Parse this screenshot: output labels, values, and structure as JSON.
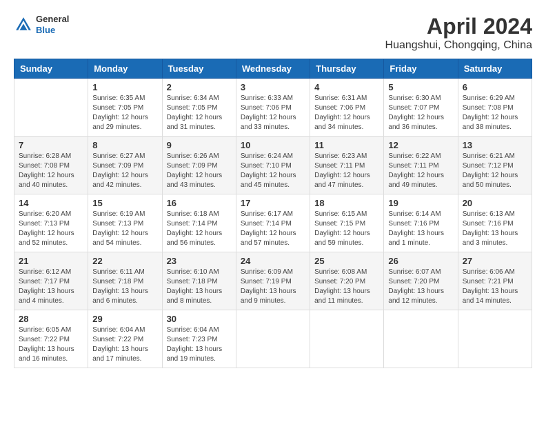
{
  "header": {
    "title": "April 2024",
    "location": "Huangshui, Chongqing, China",
    "logo_general": "General",
    "logo_blue": "Blue"
  },
  "weekdays": [
    "Sunday",
    "Monday",
    "Tuesday",
    "Wednesday",
    "Thursday",
    "Friday",
    "Saturday"
  ],
  "weeks": [
    [
      {
        "day": "",
        "sunrise": "",
        "sunset": "",
        "daylight": ""
      },
      {
        "day": "1",
        "sunrise": "Sunrise: 6:35 AM",
        "sunset": "Sunset: 7:05 PM",
        "daylight": "Daylight: 12 hours and 29 minutes."
      },
      {
        "day": "2",
        "sunrise": "Sunrise: 6:34 AM",
        "sunset": "Sunset: 7:05 PM",
        "daylight": "Daylight: 12 hours and 31 minutes."
      },
      {
        "day": "3",
        "sunrise": "Sunrise: 6:33 AM",
        "sunset": "Sunset: 7:06 PM",
        "daylight": "Daylight: 12 hours and 33 minutes."
      },
      {
        "day": "4",
        "sunrise": "Sunrise: 6:31 AM",
        "sunset": "Sunset: 7:06 PM",
        "daylight": "Daylight: 12 hours and 34 minutes."
      },
      {
        "day": "5",
        "sunrise": "Sunrise: 6:30 AM",
        "sunset": "Sunset: 7:07 PM",
        "daylight": "Daylight: 12 hours and 36 minutes."
      },
      {
        "day": "6",
        "sunrise": "Sunrise: 6:29 AM",
        "sunset": "Sunset: 7:08 PM",
        "daylight": "Daylight: 12 hours and 38 minutes."
      }
    ],
    [
      {
        "day": "7",
        "sunrise": "Sunrise: 6:28 AM",
        "sunset": "Sunset: 7:08 PM",
        "daylight": "Daylight: 12 hours and 40 minutes."
      },
      {
        "day": "8",
        "sunrise": "Sunrise: 6:27 AM",
        "sunset": "Sunset: 7:09 PM",
        "daylight": "Daylight: 12 hours and 42 minutes."
      },
      {
        "day": "9",
        "sunrise": "Sunrise: 6:26 AM",
        "sunset": "Sunset: 7:09 PM",
        "daylight": "Daylight: 12 hours and 43 minutes."
      },
      {
        "day": "10",
        "sunrise": "Sunrise: 6:24 AM",
        "sunset": "Sunset: 7:10 PM",
        "daylight": "Daylight: 12 hours and 45 minutes."
      },
      {
        "day": "11",
        "sunrise": "Sunrise: 6:23 AM",
        "sunset": "Sunset: 7:11 PM",
        "daylight": "Daylight: 12 hours and 47 minutes."
      },
      {
        "day": "12",
        "sunrise": "Sunrise: 6:22 AM",
        "sunset": "Sunset: 7:11 PM",
        "daylight": "Daylight: 12 hours and 49 minutes."
      },
      {
        "day": "13",
        "sunrise": "Sunrise: 6:21 AM",
        "sunset": "Sunset: 7:12 PM",
        "daylight": "Daylight: 12 hours and 50 minutes."
      }
    ],
    [
      {
        "day": "14",
        "sunrise": "Sunrise: 6:20 AM",
        "sunset": "Sunset: 7:13 PM",
        "daylight": "Daylight: 12 hours and 52 minutes."
      },
      {
        "day": "15",
        "sunrise": "Sunrise: 6:19 AM",
        "sunset": "Sunset: 7:13 PM",
        "daylight": "Daylight: 12 hours and 54 minutes."
      },
      {
        "day": "16",
        "sunrise": "Sunrise: 6:18 AM",
        "sunset": "Sunset: 7:14 PM",
        "daylight": "Daylight: 12 hours and 56 minutes."
      },
      {
        "day": "17",
        "sunrise": "Sunrise: 6:17 AM",
        "sunset": "Sunset: 7:14 PM",
        "daylight": "Daylight: 12 hours and 57 minutes."
      },
      {
        "day": "18",
        "sunrise": "Sunrise: 6:15 AM",
        "sunset": "Sunset: 7:15 PM",
        "daylight": "Daylight: 12 hours and 59 minutes."
      },
      {
        "day": "19",
        "sunrise": "Sunrise: 6:14 AM",
        "sunset": "Sunset: 7:16 PM",
        "daylight": "Daylight: 13 hours and 1 minute."
      },
      {
        "day": "20",
        "sunrise": "Sunrise: 6:13 AM",
        "sunset": "Sunset: 7:16 PM",
        "daylight": "Daylight: 13 hours and 3 minutes."
      }
    ],
    [
      {
        "day": "21",
        "sunrise": "Sunrise: 6:12 AM",
        "sunset": "Sunset: 7:17 PM",
        "daylight": "Daylight: 13 hours and 4 minutes."
      },
      {
        "day": "22",
        "sunrise": "Sunrise: 6:11 AM",
        "sunset": "Sunset: 7:18 PM",
        "daylight": "Daylight: 13 hours and 6 minutes."
      },
      {
        "day": "23",
        "sunrise": "Sunrise: 6:10 AM",
        "sunset": "Sunset: 7:18 PM",
        "daylight": "Daylight: 13 hours and 8 minutes."
      },
      {
        "day": "24",
        "sunrise": "Sunrise: 6:09 AM",
        "sunset": "Sunset: 7:19 PM",
        "daylight": "Daylight: 13 hours and 9 minutes."
      },
      {
        "day": "25",
        "sunrise": "Sunrise: 6:08 AM",
        "sunset": "Sunset: 7:20 PM",
        "daylight": "Daylight: 13 hours and 11 minutes."
      },
      {
        "day": "26",
        "sunrise": "Sunrise: 6:07 AM",
        "sunset": "Sunset: 7:20 PM",
        "daylight": "Daylight: 13 hours and 12 minutes."
      },
      {
        "day": "27",
        "sunrise": "Sunrise: 6:06 AM",
        "sunset": "Sunset: 7:21 PM",
        "daylight": "Daylight: 13 hours and 14 minutes."
      }
    ],
    [
      {
        "day": "28",
        "sunrise": "Sunrise: 6:05 AM",
        "sunset": "Sunset: 7:22 PM",
        "daylight": "Daylight: 13 hours and 16 minutes."
      },
      {
        "day": "29",
        "sunrise": "Sunrise: 6:04 AM",
        "sunset": "Sunset: 7:22 PM",
        "daylight": "Daylight: 13 hours and 17 minutes."
      },
      {
        "day": "30",
        "sunrise": "Sunrise: 6:04 AM",
        "sunset": "Sunset: 7:23 PM",
        "daylight": "Daylight: 13 hours and 19 minutes."
      },
      {
        "day": "",
        "sunrise": "",
        "sunset": "",
        "daylight": ""
      },
      {
        "day": "",
        "sunrise": "",
        "sunset": "",
        "daylight": ""
      },
      {
        "day": "",
        "sunrise": "",
        "sunset": "",
        "daylight": ""
      },
      {
        "day": "",
        "sunrise": "",
        "sunset": "",
        "daylight": ""
      }
    ]
  ]
}
